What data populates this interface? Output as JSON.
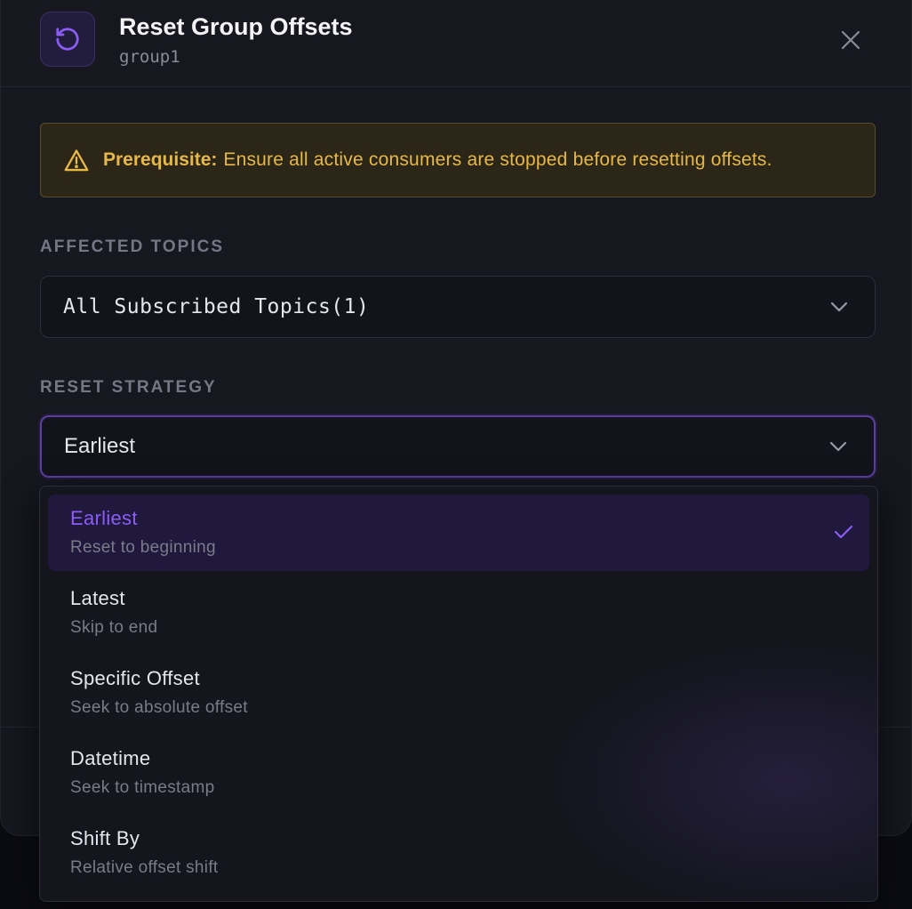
{
  "dialog": {
    "title": "Reset Group Offsets",
    "group_id": "group1",
    "header_icon": "reset-icon",
    "close_icon": "close-icon"
  },
  "alert": {
    "icon": "warning-icon",
    "label": "Prerequisite:",
    "message": "Ensure all active consumers are stopped before resetting offsets.",
    "color": "#e7b847"
  },
  "affected_topics": {
    "label": "AFFECTED TOPICS",
    "value": "All Subscribed Topics(1)"
  },
  "reset_strategy": {
    "label": "RESET STRATEGY",
    "value": "Earliest",
    "options": [
      {
        "label": "Earliest",
        "description": "Reset to beginning",
        "selected": true
      },
      {
        "label": "Latest",
        "description": "Skip to end",
        "selected": false
      },
      {
        "label": "Specific Offset",
        "description": "Seek to absolute offset",
        "selected": false
      },
      {
        "label": "Datetime",
        "description": "Seek to timestamp",
        "selected": false
      },
      {
        "label": "Shift By",
        "description": "Relative offset shift",
        "selected": false
      }
    ]
  },
  "colors": {
    "accent": "#8b5cf6",
    "background": "#16171f",
    "warning": "#e7b847"
  }
}
